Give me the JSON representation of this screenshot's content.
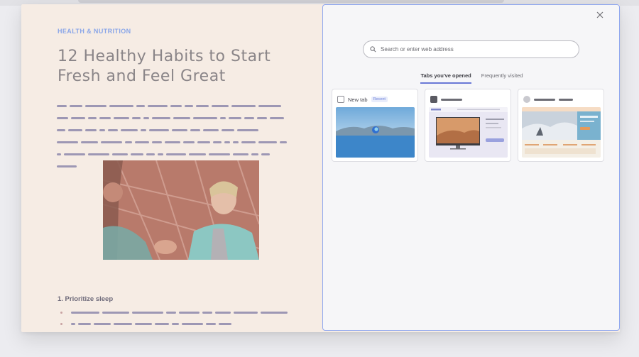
{
  "article": {
    "kicker": "HEALTH & NUTRITION",
    "headline": "12 Healthy Habits to Start Fresh and Feel Great",
    "section_title": "1. Prioritize sleep"
  },
  "newtab": {
    "search_placeholder": "Search or enter web address",
    "tabs": [
      {
        "label": "Tabs you've opened",
        "active": true
      },
      {
        "label": "Frequently visited",
        "active": false
      }
    ],
    "cards": [
      {
        "title": "New tab",
        "badge": "Recent",
        "icon": "page-icon"
      },
      {
        "title": "",
        "badge": "",
        "icon": "site-icon"
      },
      {
        "title": "",
        "badge": "",
        "icon": "profile-icon"
      }
    ],
    "close_icon": "close-icon"
  },
  "colors": {
    "accent": "#6a78d6",
    "kicker": "#8aa6e8",
    "panel_border": "#8fa7ef",
    "page_bg": "#f6ece4"
  }
}
